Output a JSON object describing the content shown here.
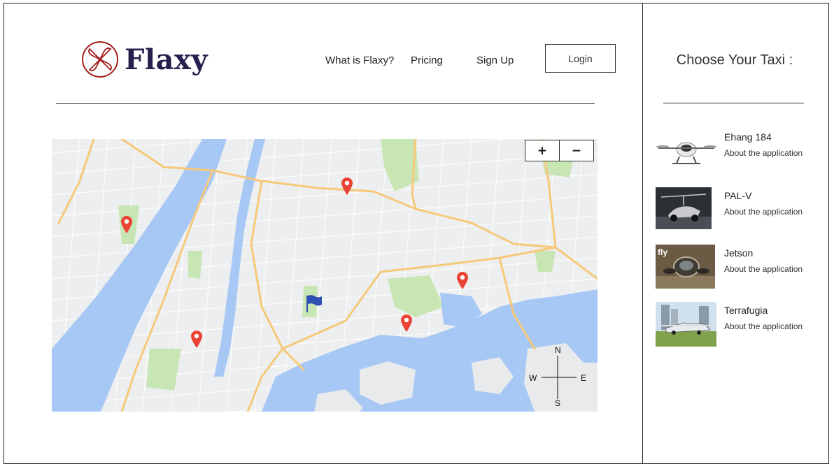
{
  "brand": {
    "name": "Flaxy",
    "color": "#241f4c",
    "mark_color": "#a31d1d"
  },
  "nav": {
    "items": [
      {
        "label": "What is Flaxy?"
      },
      {
        "label": "Pricing"
      },
      {
        "label": "Sign Up"
      }
    ],
    "login_label": "Login"
  },
  "map": {
    "zoom_in_label": "+",
    "zoom_out_label": "−",
    "compass": {
      "north": "N",
      "south": "S",
      "east": "E",
      "west": "W"
    },
    "marker_color": "#ea4335",
    "destination_flag_color": "#2f4fb3"
  },
  "sidebar": {
    "title": "Choose Your Taxi :",
    "taxis": [
      {
        "name": "Ehang 184",
        "subtitle": "About the application",
        "thumb_icon": "drone-taxi-icon"
      },
      {
        "name": "PAL-V",
        "subtitle": "About the application",
        "thumb_icon": "gyrocopter-car-icon"
      },
      {
        "name": "Jetson",
        "subtitle": "About the application",
        "thumb_badge": "fly",
        "thumb_icon": "jet-pod-icon"
      },
      {
        "name": "Terrafugia",
        "subtitle": "About the application",
        "thumb_icon": "flying-car-icon"
      }
    ]
  }
}
